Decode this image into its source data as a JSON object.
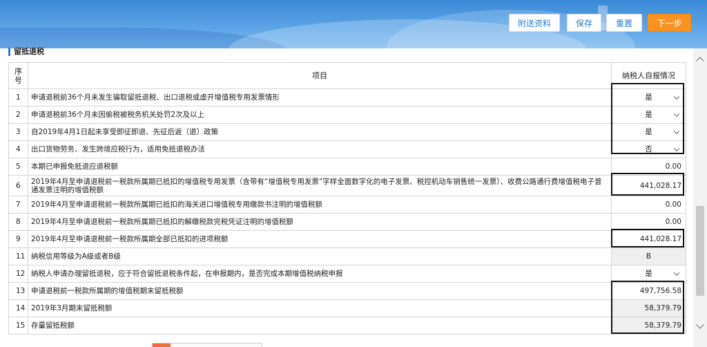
{
  "toolbar": {
    "attach_label": "附送资料",
    "save_label": "保存",
    "reset_label": "重置",
    "next_label": "下一步"
  },
  "section": {
    "title": "留抵退税"
  },
  "table": {
    "headers": {
      "no": "序号",
      "item": "项目",
      "status": "纳税人自报情况"
    },
    "rows": [
      {
        "no": "1",
        "item": "申请退税前36个月未发生骗取留抵退税、出口退税或虚开增值税专用发票情形",
        "value": "是",
        "kind": "select"
      },
      {
        "no": "2",
        "item": "申请退税前36个月未因偷税被税务机关处罚2次及以上",
        "value": "是",
        "kind": "select"
      },
      {
        "no": "3",
        "item": "自2019年4月1日起未享受即征即退、先征后返（退）政策",
        "value": "是",
        "kind": "select"
      },
      {
        "no": "4",
        "item": "出口货物劳务、发生跨境应税行为，适用免抵退税办法",
        "value": "否",
        "kind": "select"
      },
      {
        "no": "5",
        "item": "本期已申报免抵退应退税额",
        "value": "0.00",
        "kind": "value"
      },
      {
        "no": "6",
        "item": "2019年4月至申请退税前一税款所属期已抵扣的增值税专用发票（含带有“增值税专用发票”字样全面数字化的电子发票、税控机动车销售统一发票）、收费公路通行费增值税电子普通发票注明的增值税额",
        "value": "441,028.17",
        "kind": "value"
      },
      {
        "no": "7",
        "item": "2019年4月至申请退税前一税款所属期已抵扣的海关进口增值税专用缴款书注明的增值税额",
        "value": "0.00",
        "kind": "value"
      },
      {
        "no": "8",
        "item": "2019年4月至申请退税前一税款所属期已抵扣的解缴税款完税凭证注明的增值税额",
        "value": "0.00",
        "kind": "value"
      },
      {
        "no": "9",
        "item": "2019年4月至申请退税前一税款所属期全部已抵扣的进项税额",
        "value": "441,028.17",
        "kind": "value"
      },
      {
        "no": "11",
        "item": "纳税信用等级为A级或者B级",
        "value": "B",
        "kind": "grey-center"
      },
      {
        "no": "12",
        "item": "纳税人申请办理留抵退税，应于符合留抵退税条件起，在申报期内，是否完成本期增值税纳税申报",
        "value": "是",
        "kind": "select"
      },
      {
        "no": "13",
        "item": "申请退税前一税款所属期的增值税期末留抵税额",
        "value": "497,756.58",
        "kind": "value"
      },
      {
        "no": "14",
        "item": "2019年3月期末留抵税额",
        "value": "58,379.79",
        "kind": "grey-value"
      },
      {
        "no": "15",
        "item": "存量留抵税额",
        "value": "58,379.79",
        "kind": "grey-value"
      }
    ]
  },
  "colors": {
    "banner": "#3a8ad8",
    "accent": "#2b7cd3",
    "next_button": "#f7931e"
  }
}
